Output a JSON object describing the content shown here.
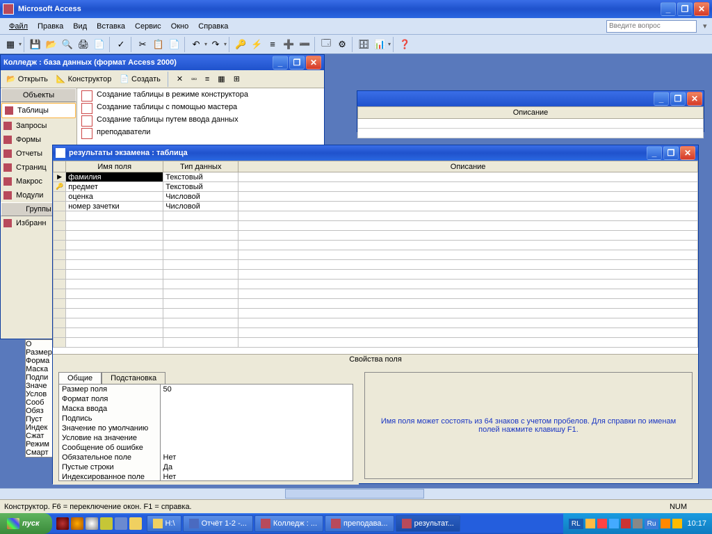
{
  "app": {
    "title": "Microsoft Access"
  },
  "menubar": {
    "file": "Файл",
    "edit": "Правка",
    "view": "Вид",
    "insert": "Вставка",
    "tools": "Сервис",
    "window": "Окно",
    "help": "Справка",
    "question_placeholder": "Введите вопрос"
  },
  "dbwin": {
    "title": "Колледж : база данных (формат Access 2000)",
    "toolbar": {
      "open": "Открыть",
      "design": "Конструктор",
      "create": "Создать"
    },
    "obj_header": "Объекты",
    "groups_header": "Группы",
    "objects": [
      "Таблицы",
      "Запросы",
      "Формы",
      "Отчеты",
      "Страниц",
      "Макрос",
      "Модули"
    ],
    "groups": [
      "Избранн"
    ],
    "items": [
      "Создание таблицы в режиме конструктора",
      "Создание таблицы с помощью мастера",
      "Создание таблицы путем ввода данных",
      "преподаватели"
    ]
  },
  "smallwin": {
    "desc_header": "Описание"
  },
  "tablewin": {
    "title": "результаты экзамена : таблица",
    "col_name": "Имя поля",
    "col_type": "Тип данных",
    "col_desc": "Описание",
    "rows": [
      {
        "sel": "▶",
        "name": "фамилия",
        "type": "Текстовый"
      },
      {
        "sel": "🔑",
        "name": "предмет",
        "type": "Текстовый"
      },
      {
        "sel": "",
        "name": "оценка",
        "type": "Числовой"
      },
      {
        "sel": "",
        "name": "номер зачетки",
        "type": "Числовой"
      }
    ],
    "props_title": "Свойства поля",
    "tab_general": "Общие",
    "tab_lookup": "Подстановка",
    "props": [
      {
        "label": "Размер поля",
        "value": "50"
      },
      {
        "label": "Формат поля",
        "value": ""
      },
      {
        "label": "Маска ввода",
        "value": ""
      },
      {
        "label": "Подпись",
        "value": ""
      },
      {
        "label": "Значение по умолчанию",
        "value": ""
      },
      {
        "label": "Условие на значение",
        "value": ""
      },
      {
        "label": "Сообщение об ошибке",
        "value": ""
      },
      {
        "label": "Обязательное поле",
        "value": "Нет"
      },
      {
        "label": "Пустые строки",
        "value": "Да"
      },
      {
        "label": "Индексированное поле",
        "value": "Нет"
      }
    ],
    "help": "Имя поля может состоять из 64 знаков с учетом пробелов.  Для справки по именам полей нажмите клавишу F1."
  },
  "hidden_props": [
    "О",
    "Размер",
    "Форма",
    "Маска",
    "Подпи",
    "Значе",
    "Услов",
    "Сооб",
    "Обяз",
    "Пуст",
    "Индек",
    "Сжат",
    "Режим",
    "Смарт"
  ],
  "status": {
    "text": "Конструктор.  F6 = переключение окон.  F1 = справка.",
    "num": "NUM"
  },
  "taskbar": {
    "start": "пуск",
    "tasks": [
      {
        "label": "H:\\"
      },
      {
        "label": "Отчёт 1-2 -..."
      },
      {
        "label": "Колледж : ..."
      },
      {
        "label": "преподава..."
      },
      {
        "label": "результат..."
      }
    ],
    "lang1": "RL",
    "lang2": "Ru",
    "clock": "10:17"
  }
}
